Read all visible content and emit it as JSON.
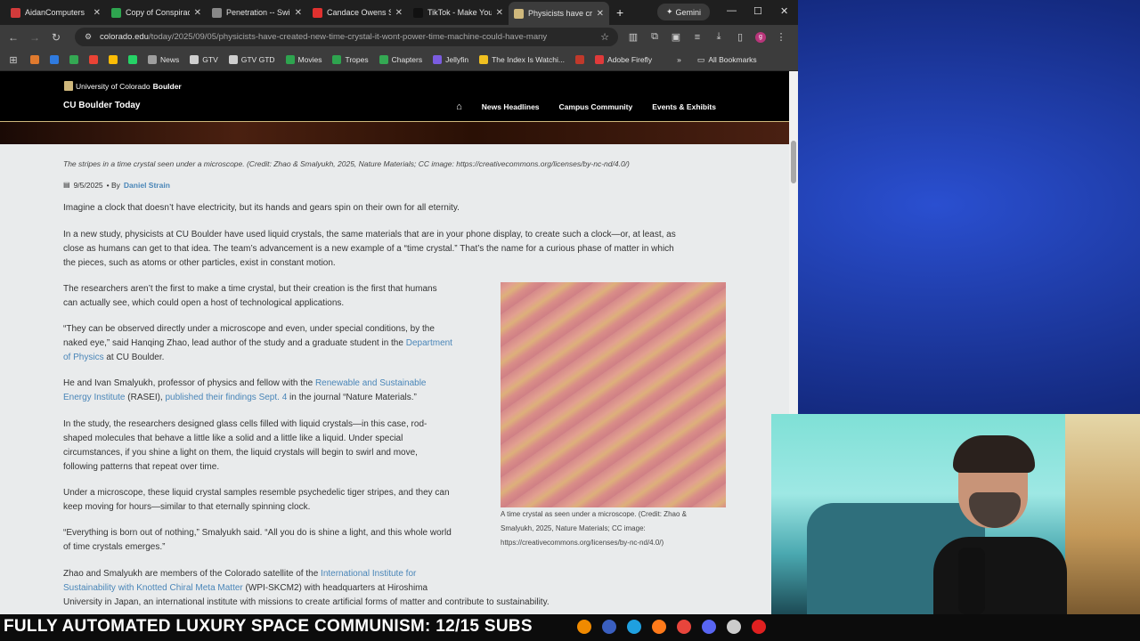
{
  "browser": {
    "tabs": [
      {
        "title": "AidanComputers",
        "color": "#d23b3b",
        "active": false
      },
      {
        "title": "Copy of Conspirac",
        "color": "#2ea44f",
        "active": false
      },
      {
        "title": "Penetration -- Swi",
        "color": "#888888",
        "active": false
      },
      {
        "title": "Candace Owens S",
        "color": "#e0312f",
        "active": false
      },
      {
        "title": "TikTok - Make You",
        "color": "#111111",
        "active": false
      },
      {
        "title": "Physicists have cr",
        "color": "#cfb87c",
        "active": true
      }
    ],
    "gemini_label": "Gemini",
    "url_host": "colorado.edu",
    "url_path": "/today/2025/09/05/physicists-have-created-new-time-crystal-it-wont-power-time-machine-could-have-many",
    "profile_initial": "g",
    "bookmarks": [
      {
        "label": "",
        "color": "#e07a2e"
      },
      {
        "label": "",
        "color": "#2f7be0"
      },
      {
        "label": "",
        "color": "#34a853"
      },
      {
        "label": "",
        "color": "#ea4335"
      },
      {
        "label": "",
        "color": "#fbbc05"
      },
      {
        "label": "",
        "color": "#25d366"
      },
      {
        "label": "News",
        "color": "#9e9e9e"
      },
      {
        "label": "GTV",
        "color": "#cfcfcf"
      },
      {
        "label": "GTV GTD",
        "color": "#cfcfcf"
      },
      {
        "label": "Movies",
        "color": "#2ea44f"
      },
      {
        "label": "Tropes",
        "color": "#2ea44f"
      },
      {
        "label": "Chapters",
        "color": "#34a853"
      },
      {
        "label": "Jellyfin",
        "color": "#7b5ce0"
      },
      {
        "label": "The Index Is Watchi...",
        "color": "#f0c020"
      },
      {
        "label": "",
        "color": "#c0392b"
      },
      {
        "label": "Adobe Firefly",
        "color": "#e03a3a"
      }
    ],
    "all_bookmarks_label": "All Bookmarks"
  },
  "site": {
    "university_prefix": "University of Colorado",
    "university_bold": "Boulder",
    "site_name": "CU Boulder Today",
    "nav": [
      "News Headlines",
      "Campus Community",
      "Events & Exhibits"
    ]
  },
  "article": {
    "top_caption": "The stripes in a time crystal seen under a microscope. (Credit: Zhao & Smalyukh, 2025, Nature Materials; CC image: https://creativecommons.org/licenses/by-nc-nd/4.0/)",
    "date": "9/5/2025",
    "by": "• By",
    "author": "Daniel Strain",
    "p1": "Imagine a clock that doesn’t have electricity, but its hands and gears spin on their own for all eternity.",
    "p2_lines": [
      "In a new study, physicists at CU Boulder have used liquid crystals, the same materials that are in your phone display, to create such a clock—or, at least, as",
      "close as humans can get to that idea. The team’s advancement is a new example of a “time crystal.” That’s the name for a curious phase of matter in which",
      "the pieces, such as atoms or other particles, exist in constant motion."
    ],
    "p3_lines": [
      "The researchers aren’t the first to make a time crystal, but their creation is the first that humans",
      "can actually see, which could open a host of technological applications."
    ],
    "p4_line1": "“They can be observed directly under a microscope and even, under special conditions, by the",
    "p4_line2_pre": "naked eye,” said Hanqing Zhao, lead author of the study and a graduate student in the",
    "p4_link": "Department",
    "p4_link2": "of Physics",
    "p4_post": "at CU Boulder.",
    "p5_pre": "He and Ivan Smalyukh, professor of physics and fellow with the",
    "p5_link1": "Renewable and Sustainable",
    "p5_link1b": "Energy Institute",
    "p5_mid": "(RASEI),",
    "p5_link2": "published their findings Sept. 4",
    "p5_post": "in the journal “Nature Materials.”",
    "p6_lines": [
      "In the study, the researchers designed glass cells filled with liquid crystals—in this case, rod-",
      "shaped molecules that behave a little like a solid and a little like a liquid. Under special",
      "circumstances, if you shine a light on them, the liquid crystals will begin to swirl and move,",
      "following patterns that repeat over time."
    ],
    "p7_lines": [
      "Under a microscope, these liquid crystal samples resemble psychedelic tiger stripes, and they can",
      "keep moving for hours—similar to that eternally spinning clock."
    ],
    "p8_lines": [
      "“Everything is born out of nothing,” Smalyukh said. “All you do is shine a light, and this whole world",
      "of time crystals emerges.”"
    ],
    "p9_pre": "Zhao and Smalyukh are members of the Colorado satellite of the",
    "p9_link1": "International Institute for",
    "p9_link1b": "Sustainability with Knotted Chiral Meta Matter",
    "p9_mid": "(WPI-SKCM2) with headquarters at Hiroshima",
    "p9_line3": "University in Japan, an international institute with missions to create artificial forms of matter and contribute to sustainability.",
    "figure_caption_lines": [
      "A time crystal as seen under a microscope. (Credit: Zhao &",
      "Smalyukh, 2025, Nature Materials; CC image:",
      "https://creativecommons.org/licenses/by-nc-nd/4.0/)"
    ]
  },
  "overlay": {
    "ticker": "FULLY AUTOMATED LUXURY SPACE COMMUNISM: 12/15 SUBS"
  },
  "taskbar_icons": [
    {
      "name": "vlc-icon",
      "color": "#f08a00"
    },
    {
      "name": "bitwarden-icon",
      "color": "#3a5fc0"
    },
    {
      "name": "edge-icon",
      "color": "#1fa0e0"
    },
    {
      "name": "firefox-icon",
      "color": "#ff7a1a"
    },
    {
      "name": "chrome-icon",
      "color": "#e8453c"
    },
    {
      "name": "discord-icon",
      "color": "#5865f2"
    },
    {
      "name": "steam-icon",
      "color": "#cccccc"
    },
    {
      "name": "youtube-icon",
      "color": "#e02020"
    }
  ]
}
